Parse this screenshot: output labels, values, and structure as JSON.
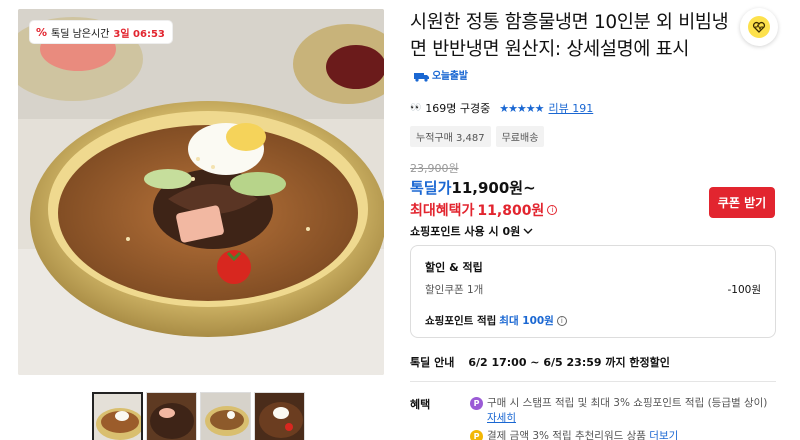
{
  "deal_badge": {
    "icon": "percent-icon",
    "label": "톡딜 남은시간",
    "time": "3일 06:53",
    "accent_color": "#e2252f"
  },
  "product": {
    "title": "시원한 정통 함흥물냉면 10인분 외 비빔냉면 반반냉면 원산지: 상세설명에 표시",
    "shipping_badge": "오늘출발",
    "viewers": "169명 구경중",
    "rating_stars": "★★★★★",
    "review_label": "리뷰 191"
  },
  "tags": [
    "누적구매 3,487",
    "무료배송"
  ],
  "price": {
    "original": "23,900원",
    "deal_label": "톡딜가",
    "deal_value": "11,900원~",
    "max_label": "최대혜택가",
    "max_value": "11,800원",
    "coupon_button": "쿠폰 받기"
  },
  "points_toggle": "쇼핑포인트 사용 시 0원",
  "discount_box": {
    "header": "할인 & 적립",
    "coupon_label": "할인쿠폰 1개",
    "coupon_amount": "-100원",
    "points_label": "쇼핑포인트 적립",
    "points_highlight": "최대 100원"
  },
  "deal_info": {
    "label": "톡딜 안내",
    "value": "6/2 17:00 ~ 6/5 23:59 까지 한정할인"
  },
  "benefits": {
    "label": "혜택",
    "item1": "구매 시 스탬프 적립 및 최대 3% 쇼핑포인트 적립 (등급별 상이)",
    "item1_link": "자세히",
    "item2": "결제 금액 3% 적립 추천리워드 상품",
    "item2_link": "더보기"
  },
  "colors": {
    "brand_blue": "#1a67d2",
    "deal_red": "#e2252f"
  }
}
